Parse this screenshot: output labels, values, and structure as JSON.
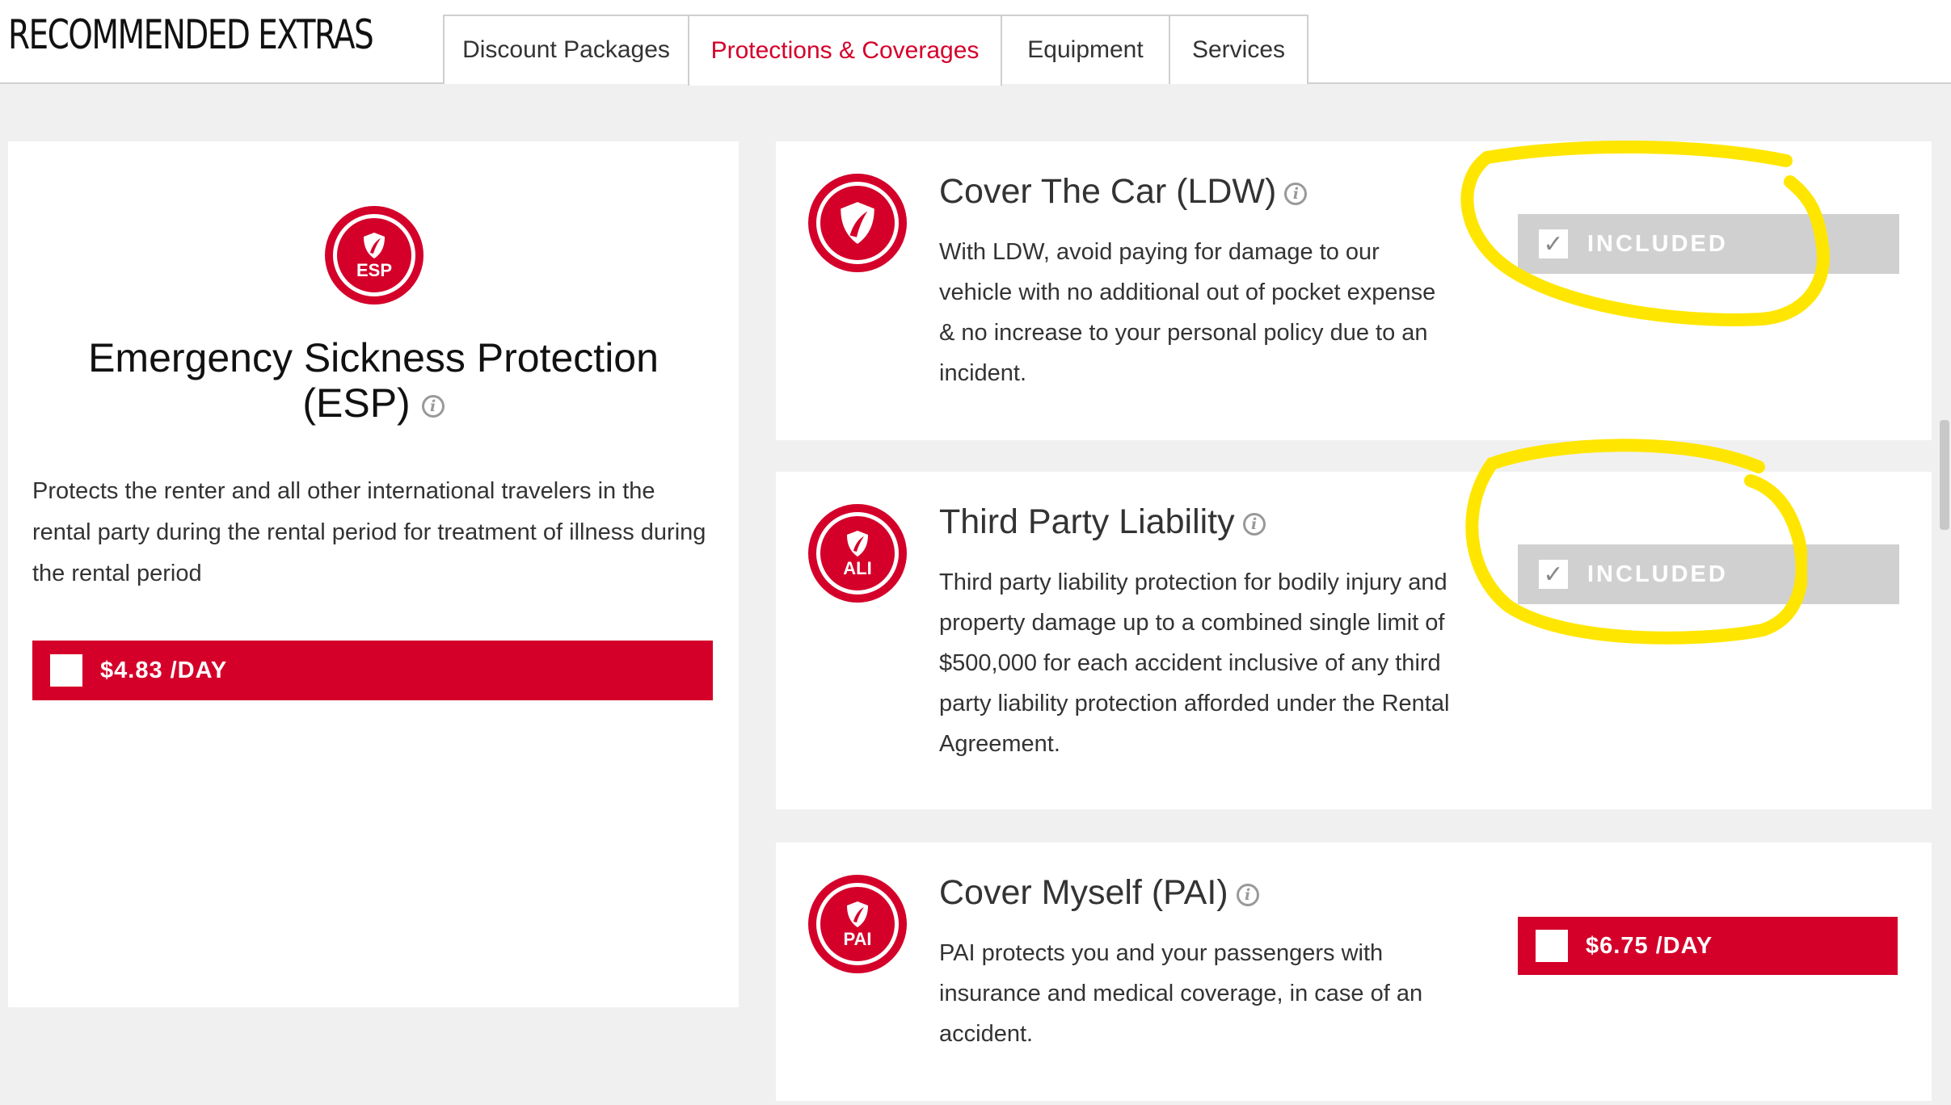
{
  "header": {
    "title": "RECOMMENDED EXTRAS",
    "tabs": [
      {
        "label": "Discount Packages"
      },
      {
        "label": "Protections & Coverages"
      },
      {
        "label": "Equipment"
      },
      {
        "label": "Services"
      }
    ],
    "active_tab": "Protections & Coverages"
  },
  "esp": {
    "badge": "ESP",
    "title_line1": "Emergency Sickness Protection",
    "title_line2": "(ESP)",
    "description": "Protects the renter and all other international travelers in the rental party during the rental period for treatment of illness during the rental period",
    "price": "$4.83 /DAY"
  },
  "coverages": [
    {
      "badge": "",
      "title": "Cover The Car (LDW)",
      "description": "With LDW, avoid paying for damage to our vehicle with no additional out of pocket expense & no increase to your personal policy due to an incident.",
      "status": "INCLUDED"
    },
    {
      "badge": "ALI",
      "title": "Third Party Liability",
      "description": "Third party liability protection for bodily injury and property damage up to a combined single limit of $500,000 for each accident inclusive of any third party liability protection afforded under the Rental Agreement.",
      "status": "INCLUDED"
    },
    {
      "badge": "PAI",
      "title": "Cover Myself (PAI)",
      "description": "PAI protects you and your passengers with insurance and medical coverage, in case of an accident.",
      "price": "$6.75 /DAY"
    }
  ],
  "colors": {
    "brand_red": "#d4002a",
    "included_gray": "#d0d0d0",
    "highlight_yellow": "#ffe600"
  }
}
